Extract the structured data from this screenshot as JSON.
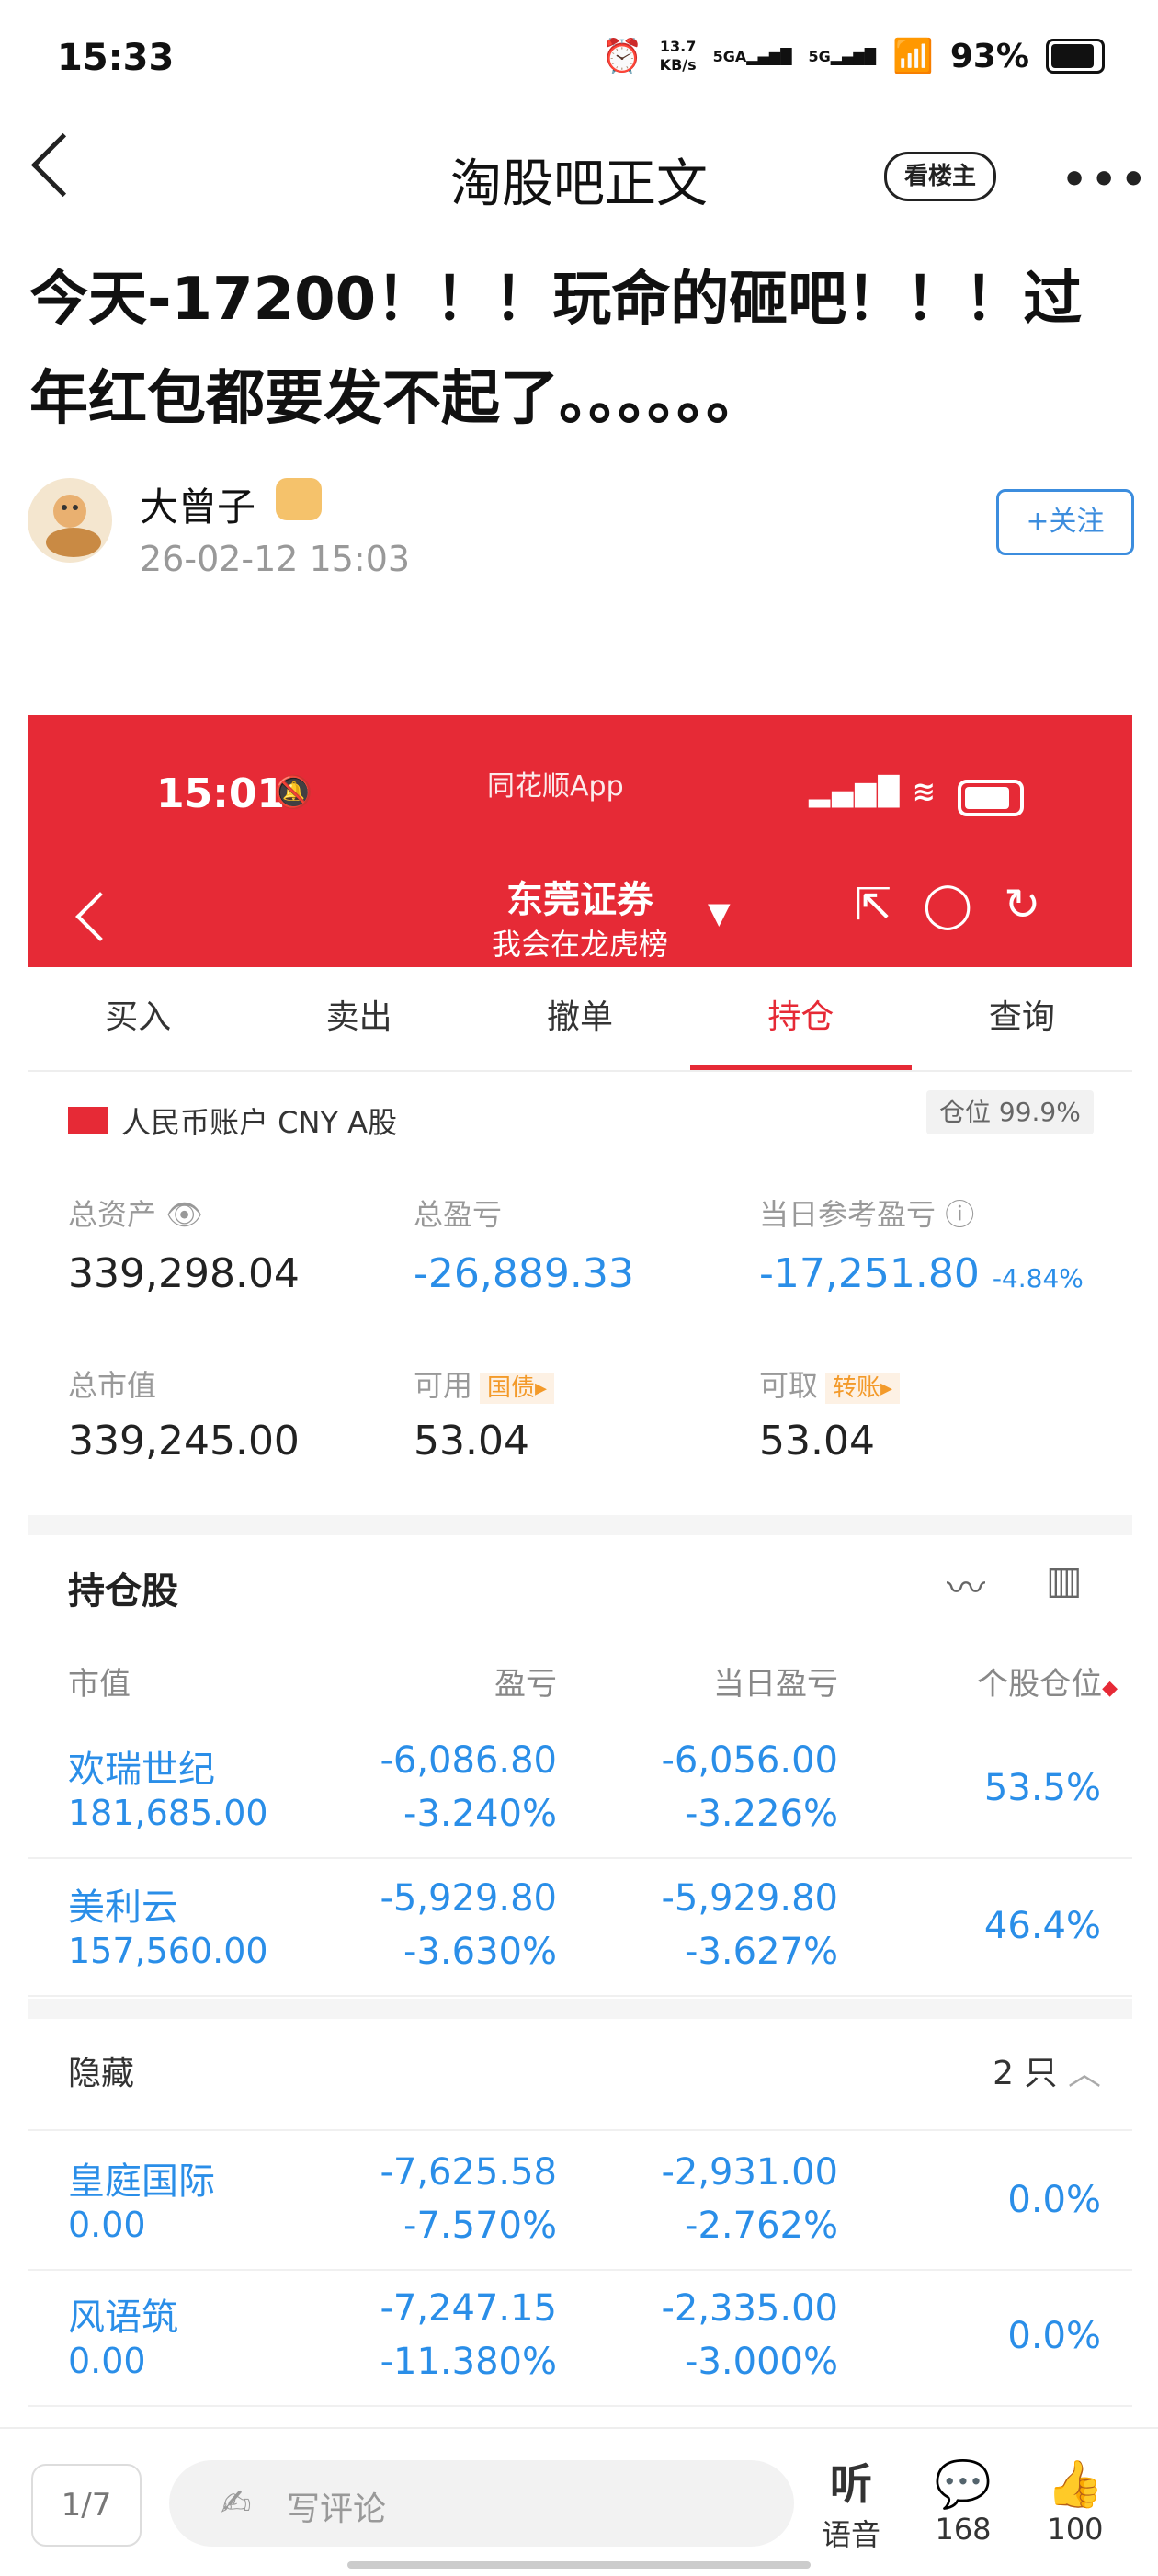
{
  "status_bar": {
    "time": "15:33",
    "net_speed_value": "13.7",
    "net_speed_unit": "KB/s",
    "net1": "5GA",
    "net2": "5G",
    "battery": "93%"
  },
  "header": {
    "title": "淘股吧正文",
    "louzhu_label": "看楼主",
    "more": "•••"
  },
  "post": {
    "title": "今天-17200！！！玩命的砸吧！！！过年红包都要发不起了。。。。。。",
    "author": "大曾子",
    "time": "26-02-12 15:03",
    "follow_label": "+关注"
  },
  "screenshot": {
    "status_time": "15:01",
    "app_name": "同花顺App",
    "broker": "东莞证券",
    "broker_sub": "我会在龙虎榜",
    "tabs": [
      {
        "label": "买入"
      },
      {
        "label": "卖出"
      },
      {
        "label": "撤单"
      },
      {
        "label": "持仓"
      },
      {
        "label": "查询"
      }
    ],
    "active_tab": "持仓",
    "account": {
      "label": "人民币账户 CNY A股",
      "position_label": "仓位 99.9%"
    },
    "summary": {
      "total_assets_label": "总资产",
      "total_assets": "339,298.04",
      "total_pnl_label": "总盈亏",
      "total_pnl": "-26,889.33",
      "daily_pnl_label": "当日参考盈亏",
      "daily_pnl": "-17,251.80",
      "daily_pnl_pct": "-4.84%",
      "market_value_label": "总市值",
      "market_value": "339,245.00",
      "available_label": "可用",
      "available_tag": "国债▸",
      "available": "53.04",
      "withdrawable_label": "可取",
      "withdrawable_tag": "转账▸",
      "withdrawable": "53.04"
    },
    "holdings_title": "持仓股",
    "columns": [
      "市值",
      "盈亏",
      "当日盈亏",
      "个股仓位"
    ],
    "holdings": [
      {
        "name": "欢瑞世纪",
        "market_value": "181,685.00",
        "pnl": "-6,086.80",
        "pnl_pct": "-3.240%",
        "daily": "-6,056.00",
        "daily_pct": "-3.226%",
        "weight": "53.5%"
      },
      {
        "name": "美利云",
        "market_value": "157,560.00",
        "pnl": "-5,929.80",
        "pnl_pct": "-3.630%",
        "daily": "-5,929.80",
        "daily_pct": "-3.627%",
        "weight": "46.4%"
      }
    ],
    "hidden_title": "隐藏",
    "hidden_count": "2 只",
    "hidden": [
      {
        "name": "皇庭国际",
        "market_value": "0.00",
        "pnl": "-7,625.58",
        "pnl_pct": "-7.570%",
        "daily": "-2,931.00",
        "daily_pct": "-2.762%",
        "weight": "0.0%"
      },
      {
        "name": "风语筑",
        "market_value": "0.00",
        "pnl": "-7,247.15",
        "pnl_pct": "-11.380%",
        "daily": "-2,335.00",
        "daily_pct": "-3.000%",
        "weight": "0.0%"
      }
    ]
  },
  "bottom_bar": {
    "pager": "1/7",
    "comment_placeholder": "写评论",
    "voice_icon": "听",
    "voice_label": "语音",
    "comments_count": "168",
    "likes_count": "100"
  }
}
